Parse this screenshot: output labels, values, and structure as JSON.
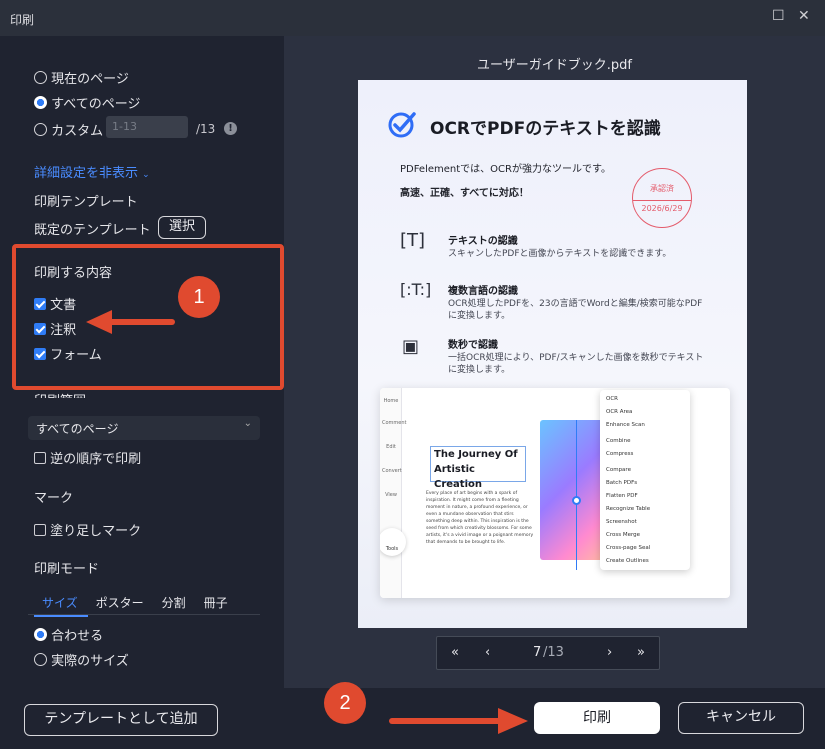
{
  "window": {
    "title": "印刷"
  },
  "range": {
    "current_page": "現在のページ",
    "all_pages": "すべてのページ",
    "custom": "カスタム",
    "custom_placeholder": "1-13",
    "total": "/13",
    "info": "!"
  },
  "details_toggle": "詳細設定を非表示",
  "template": {
    "heading": "印刷テンプレート",
    "default_label": "既定のテンプレート",
    "select_button": "選択"
  },
  "content": {
    "heading": "印刷する内容",
    "items": [
      {
        "label": "文書",
        "checked": true
      },
      {
        "label": "注釈",
        "checked": true
      },
      {
        "label": "フォーム",
        "checked": true
      }
    ]
  },
  "print_range": {
    "heading": "印刷範囲",
    "select_value": "すべてのページ",
    "reverse_order": "逆の順序で印刷"
  },
  "marks": {
    "heading": "マーク",
    "bleed": "塗り足しマーク"
  },
  "mode": {
    "heading": "印刷モード",
    "tabs": [
      "サイズ",
      "ポスター",
      "分割",
      "冊子"
    ],
    "active_tab": "サイズ",
    "fit": "合わせる",
    "actual": "実際のサイズ"
  },
  "add_template_button": "テンプレートとして追加",
  "annotations": {
    "badge1": "1",
    "badge2": "2"
  },
  "preview": {
    "filename": "ユーザーガイドブック.pdf",
    "doc_title": "OCRでPDFのテキストを認識",
    "intro1": "PDFelementでは、OCRが強力なツールです。",
    "intro2": "高速、正確、すべてに対応！",
    "stamp_top": "承認済",
    "stamp_date": "2026/6/29",
    "features": [
      {
        "title": "テキストの認識",
        "desc": "スキャンしたPDFと画像からテキストを認識できます。"
      },
      {
        "title": "複数言語の認識",
        "desc": "OCR処理したPDFを、23の言語でWordと編集/検索可能なPDFに変換します。"
      },
      {
        "title": "数秒で認識",
        "desc": "一括OCR処理により、PDF/スキャンした画像を数秒でテキストに変換します。"
      }
    ],
    "screenshot": {
      "rail": [
        "Home",
        "Comment",
        "Edit",
        "Convert",
        "View"
      ],
      "tools_label": "Tools",
      "heading1": "The Journey Of",
      "heading2": "Artistic Creation",
      "body": "Every place of art begins with a spark of inspiration. It might come from a fleeting moment in nature, a profound experience, or even a mundane observation that stirs something deep within. This inspiration is the seed from which creativity blossoms. For some artists, it's a vivid image or a poignant memory that demands to be brought to life.",
      "menu": [
        "OCR",
        "OCR Area",
        "Enhance Scan",
        "Combine",
        "Compress",
        "Compare",
        "Batch PDFs",
        "Flatten PDF",
        "Recognize Table",
        "Screenshot",
        "Cross Merge",
        "Cross-page Seal",
        "Create Outlines"
      ]
    },
    "pager": {
      "first": "«",
      "prev": "‹",
      "current": "7",
      "total": "/13",
      "next": "›",
      "last": "»"
    }
  },
  "footer": {
    "print_button": "印刷",
    "cancel_button": "キャンセル"
  },
  "colors": {
    "accent": "#2f7cf6",
    "annotation": "#e04a2f"
  }
}
